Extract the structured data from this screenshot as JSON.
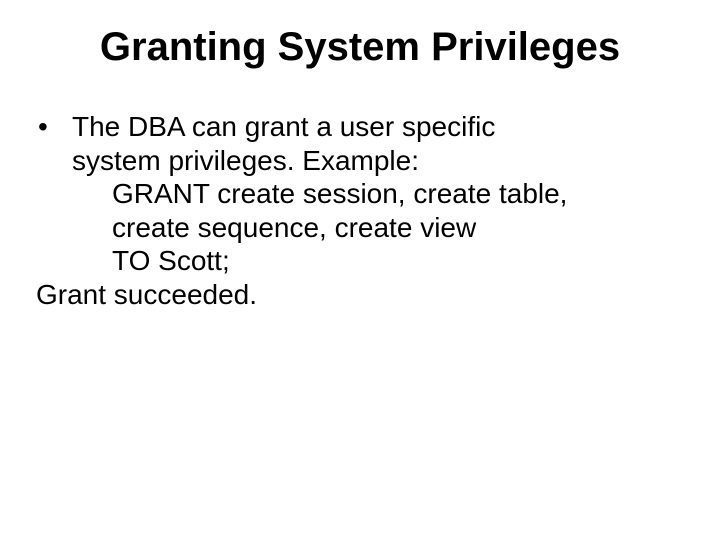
{
  "title": "Granting System Privileges",
  "bullet": {
    "dot": "•",
    "line1": "The DBA can grant a user specific",
    "line2": "system privileges. Example:"
  },
  "code": {
    "l1": "GRANT create session, create table,",
    "l2": "create sequence, create view",
    "l3": "TO Scott;"
  },
  "result": "Grant succeeded."
}
